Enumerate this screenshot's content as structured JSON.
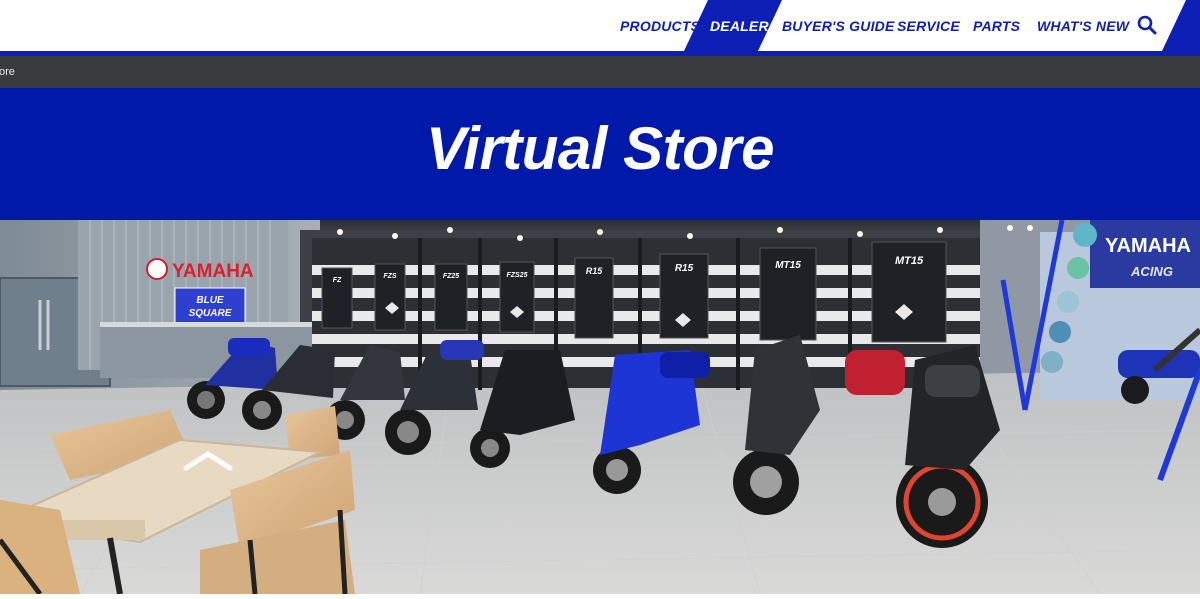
{
  "nav": {
    "items": [
      "PRODUCTS",
      "DEALER",
      "BUYER'S GUIDE",
      "SERVICE",
      "PARTS",
      "WHAT'S NEW"
    ],
    "active": "DEALER",
    "search_icon": "search-icon"
  },
  "breadcrumb": {
    "text": "ore"
  },
  "page": {
    "title": "Virtual Store"
  },
  "store": {
    "logo_text": "YAMAHA",
    "sign_text_1": "BLUE",
    "sign_text_2": "SQUARE",
    "banner_text": "YAMAHA",
    "banner_sub": "ACING",
    "poster_labels": [
      "FZ",
      "FZS",
      "FZ25",
      "FZS25",
      "R15",
      "R15",
      "MT15",
      "MT15"
    ],
    "nav_arrow_icon": "chevron-up-icon"
  },
  "colors": {
    "brand_blue": "#0d1fb4",
    "banner_blue": "#0019a8",
    "breadcrumb_bg": "#3a3b3f"
  }
}
